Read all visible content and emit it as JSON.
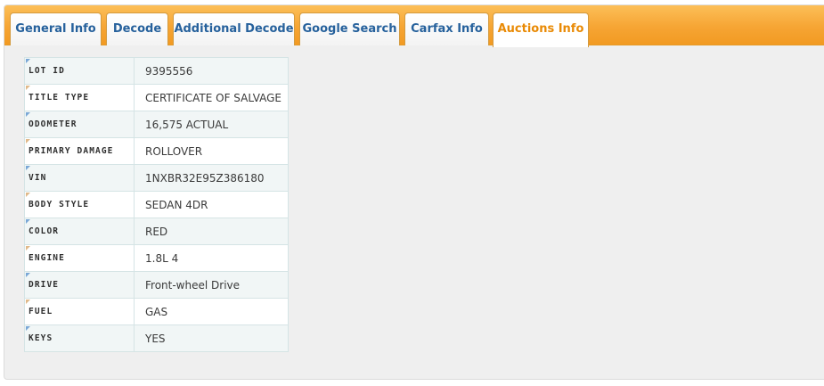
{
  "tabs": [
    {
      "label": "General Info",
      "active": false
    },
    {
      "label": "Decode",
      "active": false
    },
    {
      "label": "Additional Decode",
      "active": false
    },
    {
      "label": "Google Search",
      "active": false
    },
    {
      "label": "Carfax Info",
      "active": false
    },
    {
      "label": "Auctions Info",
      "active": true
    }
  ],
  "colors": {
    "tab_bar": "#f6a534",
    "tab_text": "#26619c",
    "active_tab_text": "#e98a05",
    "row_alt": "#f1f6f6"
  },
  "auction": {
    "rows": [
      {
        "label": "LOT ID",
        "value": "9395556"
      },
      {
        "label": "TITLE TYPE",
        "value": "CERTIFICATE OF SALVAGE"
      },
      {
        "label": "ODOMETER",
        "value": "16,575 ACTUAL"
      },
      {
        "label": "PRIMARY DAMAGE",
        "value": "ROLLOVER"
      },
      {
        "label": "VIN",
        "value": "1NXBR32E95Z386180"
      },
      {
        "label": "BODY STYLE",
        "value": "SEDAN 4DR"
      },
      {
        "label": "COLOR",
        "value": "RED"
      },
      {
        "label": "ENGINE",
        "value": "1.8L 4"
      },
      {
        "label": "DRIVE",
        "value": "Front-wheel Drive"
      },
      {
        "label": "FUEL",
        "value": "GAS"
      },
      {
        "label": "KEYS",
        "value": "YES"
      }
    ]
  }
}
